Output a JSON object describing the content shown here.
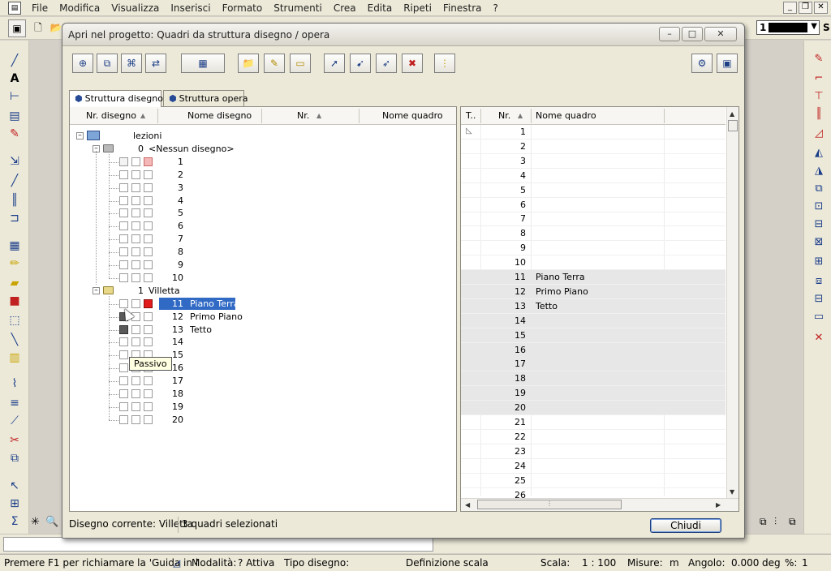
{
  "menubar": {
    "items": [
      "File",
      "Modifica",
      "Visualizza",
      "Inserisci",
      "Formato",
      "Strumenti",
      "Crea",
      "Edita",
      "Ripeti",
      "Finestra",
      "?"
    ]
  },
  "pen": {
    "number": "1",
    "extra": "S"
  },
  "dialog": {
    "title": "Apri nel progetto: Quadri da struttura disegno / opera",
    "tabs": [
      "Struttura disegno",
      "Struttura opera"
    ],
    "left_headers": {
      "nr_disegno": "Nr. disegno",
      "nome_disegno": "Nome disegno",
      "nr": "Nr.",
      "nome_quadro": "Nome quadro"
    },
    "tree": {
      "root": "lezioni",
      "group0_num": "0",
      "group0_name": "<Nessun disegno>",
      "group0_rows": [
        "1",
        "2",
        "3",
        "4",
        "5",
        "6",
        "7",
        "8",
        "9",
        "10"
      ],
      "group1_num": "1",
      "group1_name": "Villetta",
      "group1_rows": [
        {
          "num": "11",
          "name": "Piano Terra"
        },
        {
          "num": "12",
          "name": "Primo Piano"
        },
        {
          "num": "13",
          "name": "Tetto"
        },
        {
          "num": "14",
          "name": ""
        },
        {
          "num": "15",
          "name": ""
        },
        {
          "num": "16",
          "name": ""
        },
        {
          "num": "17",
          "name": ""
        },
        {
          "num": "18",
          "name": ""
        },
        {
          "num": "19",
          "name": ""
        },
        {
          "num": "20",
          "name": ""
        }
      ]
    },
    "tooltip": "Passivo",
    "right_headers": {
      "t": "T..",
      "nr": "Nr.",
      "nome_quadro": "Nome quadro"
    },
    "right_rows": [
      {
        "num": "1",
        "name": ""
      },
      {
        "num": "2",
        "name": ""
      },
      {
        "num": "3",
        "name": ""
      },
      {
        "num": "4",
        "name": ""
      },
      {
        "num": "5",
        "name": ""
      },
      {
        "num": "6",
        "name": ""
      },
      {
        "num": "7",
        "name": ""
      },
      {
        "num": "8",
        "name": ""
      },
      {
        "num": "9",
        "name": ""
      },
      {
        "num": "10",
        "name": ""
      },
      {
        "num": "11",
        "name": "Piano Terra"
      },
      {
        "num": "12",
        "name": "Primo Piano"
      },
      {
        "num": "13",
        "name": "Tetto"
      },
      {
        "num": "14",
        "name": ""
      },
      {
        "num": "15",
        "name": ""
      },
      {
        "num": "16",
        "name": ""
      },
      {
        "num": "17",
        "name": ""
      },
      {
        "num": "18",
        "name": ""
      },
      {
        "num": "19",
        "name": ""
      },
      {
        "num": "20",
        "name": ""
      },
      {
        "num": "21",
        "name": ""
      },
      {
        "num": "22",
        "name": ""
      },
      {
        "num": "23",
        "name": ""
      },
      {
        "num": "24",
        "name": ""
      },
      {
        "num": "25",
        "name": ""
      },
      {
        "num": "26",
        "name": ""
      }
    ],
    "status_current": "Disegno corrente: Villetta",
    "status_selected": "3 quadri selezionati",
    "close_label": "Chiudi"
  },
  "statusbar": {
    "help": "Premere F1 per richiamare la 'Guida in l",
    "modalita_label": "Modalità:",
    "modalita_value": "? Attiva",
    "tipo_disegno": "Tipo disegno:",
    "definizione_scala": "Definizione scala",
    "scala_label": "Scala:",
    "scala_value": "1 : 100",
    "misure_label": "Misure:",
    "misure_value": "m",
    "angolo_label": "Angolo:",
    "angolo_value": "0.000",
    "angolo_unit": "deg",
    "percent_label": "%:",
    "percent_value": "1"
  },
  "colors": {
    "selection": "#316ac5",
    "red_marker": "#e11b1b",
    "tooltip_bg": "#ffffe1"
  }
}
